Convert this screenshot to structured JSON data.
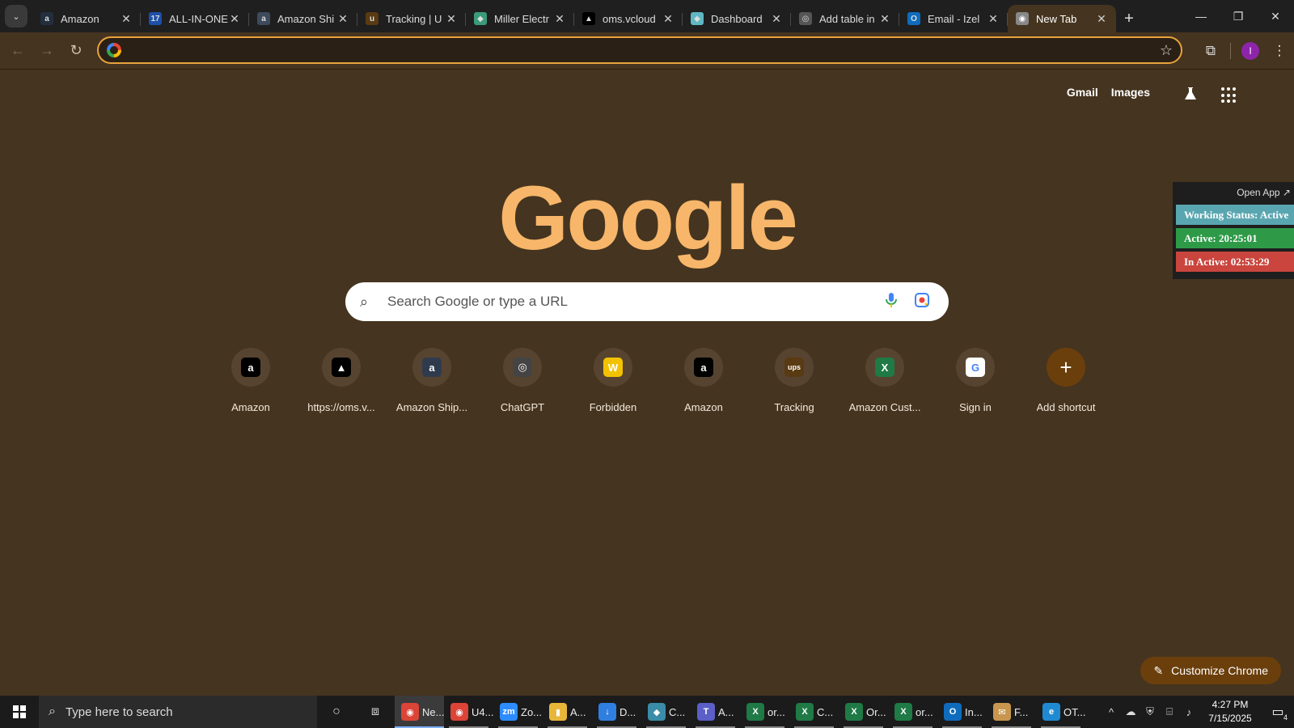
{
  "tabs": [
    {
      "title": "Amazon",
      "icon": "amazon-icon",
      "color": "#232f3e",
      "glyph": "a"
    },
    {
      "title": "ALL-IN-ONE",
      "icon": "17track-icon",
      "color": "#1e4fa8",
      "glyph": "17"
    },
    {
      "title": "Amazon Shi",
      "icon": "amazon-icon",
      "color": "#3d4a5c",
      "glyph": "a"
    },
    {
      "title": "Tracking | U",
      "icon": "ups-icon",
      "color": "#5a3a12",
      "glyph": "u"
    },
    {
      "title": "Miller Electr",
      "icon": "miller-icon",
      "color": "#3a9a7a",
      "glyph": "◆"
    },
    {
      "title": "oms.vcloud",
      "icon": "vcloud-icon",
      "color": "#000000",
      "glyph": "▲"
    },
    {
      "title": "Dashboard",
      "icon": "dashboard-icon",
      "color": "#5fb7c4",
      "glyph": "◆"
    },
    {
      "title": "Add table in",
      "icon": "chatgpt-icon",
      "color": "#555555",
      "glyph": "◎"
    },
    {
      "title": "Email - Izel",
      "icon": "outlook-icon",
      "color": "#0f6cbd",
      "glyph": "O"
    },
    {
      "title": "New Tab",
      "icon": "chrome-icon",
      "color": "#888888",
      "glyph": "◉",
      "active": true
    }
  ],
  "omnibox": {
    "value": "",
    "placeholder": ""
  },
  "profile_initial": "I",
  "header_links": {
    "gmail": "Gmail",
    "images": "Images"
  },
  "logo_text": "Google",
  "search": {
    "placeholder": "Search Google or type a URL"
  },
  "shortcuts": [
    {
      "label": "Amazon",
      "icon": "amazon-icon",
      "bg": "#000000",
      "glyph": "a"
    },
    {
      "label": "https://oms.v...",
      "icon": "vcloud-icon",
      "bg": "#000000",
      "glyph": "▲"
    },
    {
      "label": "Amazon Ship...",
      "icon": "amazon-icon",
      "bg": "#2f3b4d",
      "glyph": "a"
    },
    {
      "label": "ChatGPT",
      "icon": "chatgpt-icon",
      "bg": "#444444",
      "glyph": "◎"
    },
    {
      "label": "Forbidden",
      "icon": "forbidden-w-icon",
      "bg": "#f2c200",
      "glyph": "W"
    },
    {
      "label": "Amazon",
      "icon": "amazon-icon",
      "bg": "#000000",
      "glyph": "a"
    },
    {
      "label": "Tracking",
      "icon": "ups-icon",
      "bg": "#5a3a12",
      "glyph": "ups"
    },
    {
      "label": "Amazon Cust...",
      "icon": "excel-icon",
      "bg": "#1f7a46",
      "glyph": "X"
    },
    {
      "label": "Sign in",
      "icon": "google-icon",
      "bg": "#ffffff",
      "glyph": "G"
    }
  ],
  "add_shortcut": {
    "label": "Add shortcut"
  },
  "extension": {
    "open_app": "Open App ↗",
    "working_status": "Working Status: Active",
    "active": "Active: 20:25:01",
    "inactive": "In Active: 02:53:29"
  },
  "customize": {
    "label": "Customize Chrome"
  },
  "taskbar": {
    "search_placeholder": "Type here to search",
    "apps": [
      {
        "label": "Ne...",
        "icon": "chrome-icon",
        "color": "#db4437",
        "glyph": "◉",
        "active": true
      },
      {
        "label": "U4...",
        "icon": "chrome-icon",
        "color": "#db4437",
        "glyph": "◉"
      },
      {
        "label": "Zo...",
        "icon": "zoom-icon",
        "color": "#2d8cff",
        "glyph": "zm"
      },
      {
        "label": "A...",
        "icon": "file-explorer-icon",
        "color": "#e8b73a",
        "glyph": "▮"
      },
      {
        "label": "D...",
        "icon": "download-icon",
        "color": "#2f7fe0",
        "glyph": "↓"
      },
      {
        "label": "C...",
        "icon": "app-icon",
        "color": "#3a8ca8",
        "glyph": "◆"
      },
      {
        "label": "A...",
        "icon": "teams-icon",
        "color": "#5b5fc7",
        "glyph": "T"
      },
      {
        "label": "or...",
        "icon": "excel-icon",
        "color": "#1f7a46",
        "glyph": "X"
      },
      {
        "label": "C...",
        "icon": "excel-icon",
        "color": "#1f7a46",
        "glyph": "X"
      },
      {
        "label": "Or...",
        "icon": "excel-icon",
        "color": "#1f7a46",
        "glyph": "X"
      },
      {
        "label": "or...",
        "icon": "excel-icon",
        "color": "#1f7a46",
        "glyph": "X"
      },
      {
        "label": "In...",
        "icon": "outlook-icon",
        "color": "#0f6cbd",
        "glyph": "O"
      },
      {
        "label": "F...",
        "icon": "mail-icon",
        "color": "#c8964e",
        "glyph": "✉"
      },
      {
        "label": "OT...",
        "icon": "edge-icon",
        "color": "#1f8ad2",
        "glyph": "e"
      }
    ],
    "time": "4:27 PM",
    "date": "7/15/2025",
    "notification_count": "4"
  }
}
